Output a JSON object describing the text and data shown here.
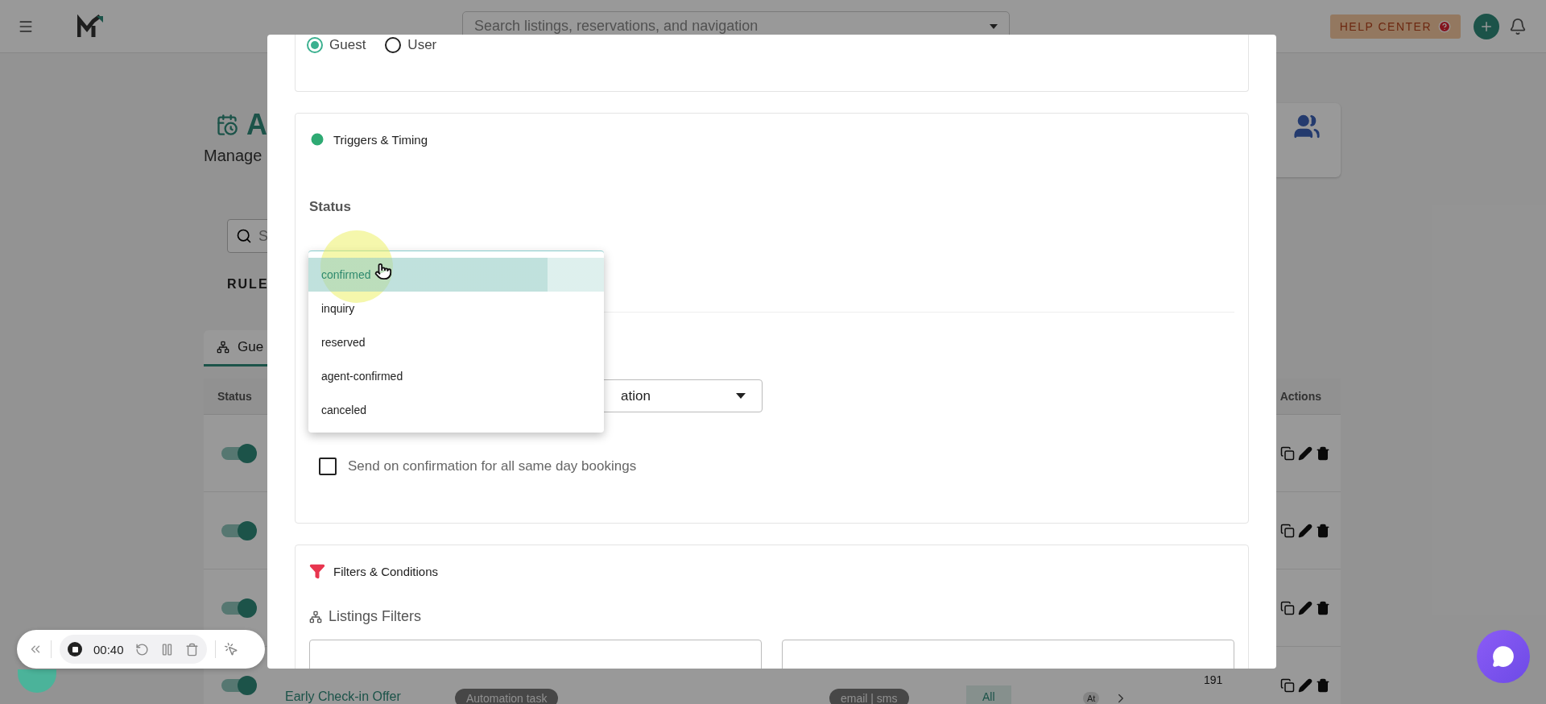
{
  "topbar": {
    "search_placeholder": "Search listings, reservations, and navigation",
    "help_button": "HELP CENTER"
  },
  "page": {
    "title": "A",
    "subtitle": "Manage",
    "search_placeholder": "S",
    "section_label": "RULE",
    "tabs": [
      {
        "label": "Gue",
        "selected": true
      }
    ],
    "table": {
      "columns": [
        "Status",
        "Actions"
      ],
      "rows": [
        {
          "on": true
        },
        {
          "on": true
        },
        {
          "on": true
        },
        {
          "on": true,
          "name": "Early Check-in Offer",
          "type": "Automation task",
          "channels": "email | sms",
          "scope": "All",
          "timing": "At",
          "count": "191"
        }
      ]
    }
  },
  "modal": {
    "recipient": [
      {
        "label": "Guest",
        "selected": true
      },
      {
        "label": "User",
        "selected": false
      }
    ],
    "triggers": {
      "title": "Triggers & Timing",
      "status_label": "Status",
      "status_menu": [
        {
          "label": "confirmed",
          "selected": true
        },
        {
          "label": "inquiry",
          "selected": false
        },
        {
          "label": "reserved",
          "selected": false
        },
        {
          "label": "agent-confirmed",
          "selected": false
        },
        {
          "label": "canceled",
          "selected": false
        }
      ],
      "event_select": {
        "value": "ation"
      },
      "same_day": {
        "label": "Send on confirmation for all same day bookings",
        "checked": false
      }
    },
    "filters": {
      "title": "Filters & Conditions",
      "listings_title": "Listings Filters"
    }
  },
  "recorder": {
    "time": "00:40"
  }
}
